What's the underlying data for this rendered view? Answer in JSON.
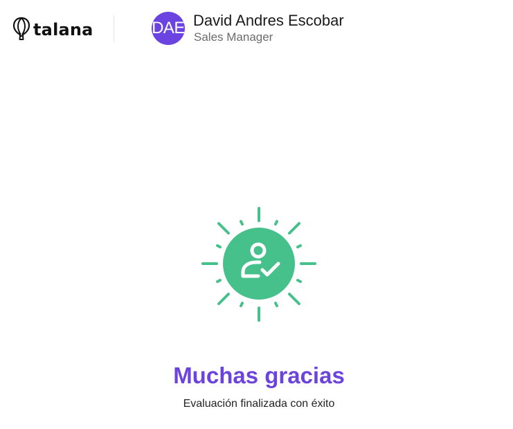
{
  "header": {
    "brand": {
      "icon": "balloon-logo-icon",
      "name": "talana"
    },
    "user": {
      "initials": "DAE",
      "name": "David Andres Escobar",
      "role": "Sales Manager",
      "avatar_color": "#6a43e0"
    }
  },
  "main": {
    "illustration_icon": "user-check-sunburst-icon",
    "accent_color": "#47c18b",
    "title": "Muchas gracias",
    "title_color": "#6c44dc",
    "subtitle": "Evaluación finalizada con éxito"
  }
}
